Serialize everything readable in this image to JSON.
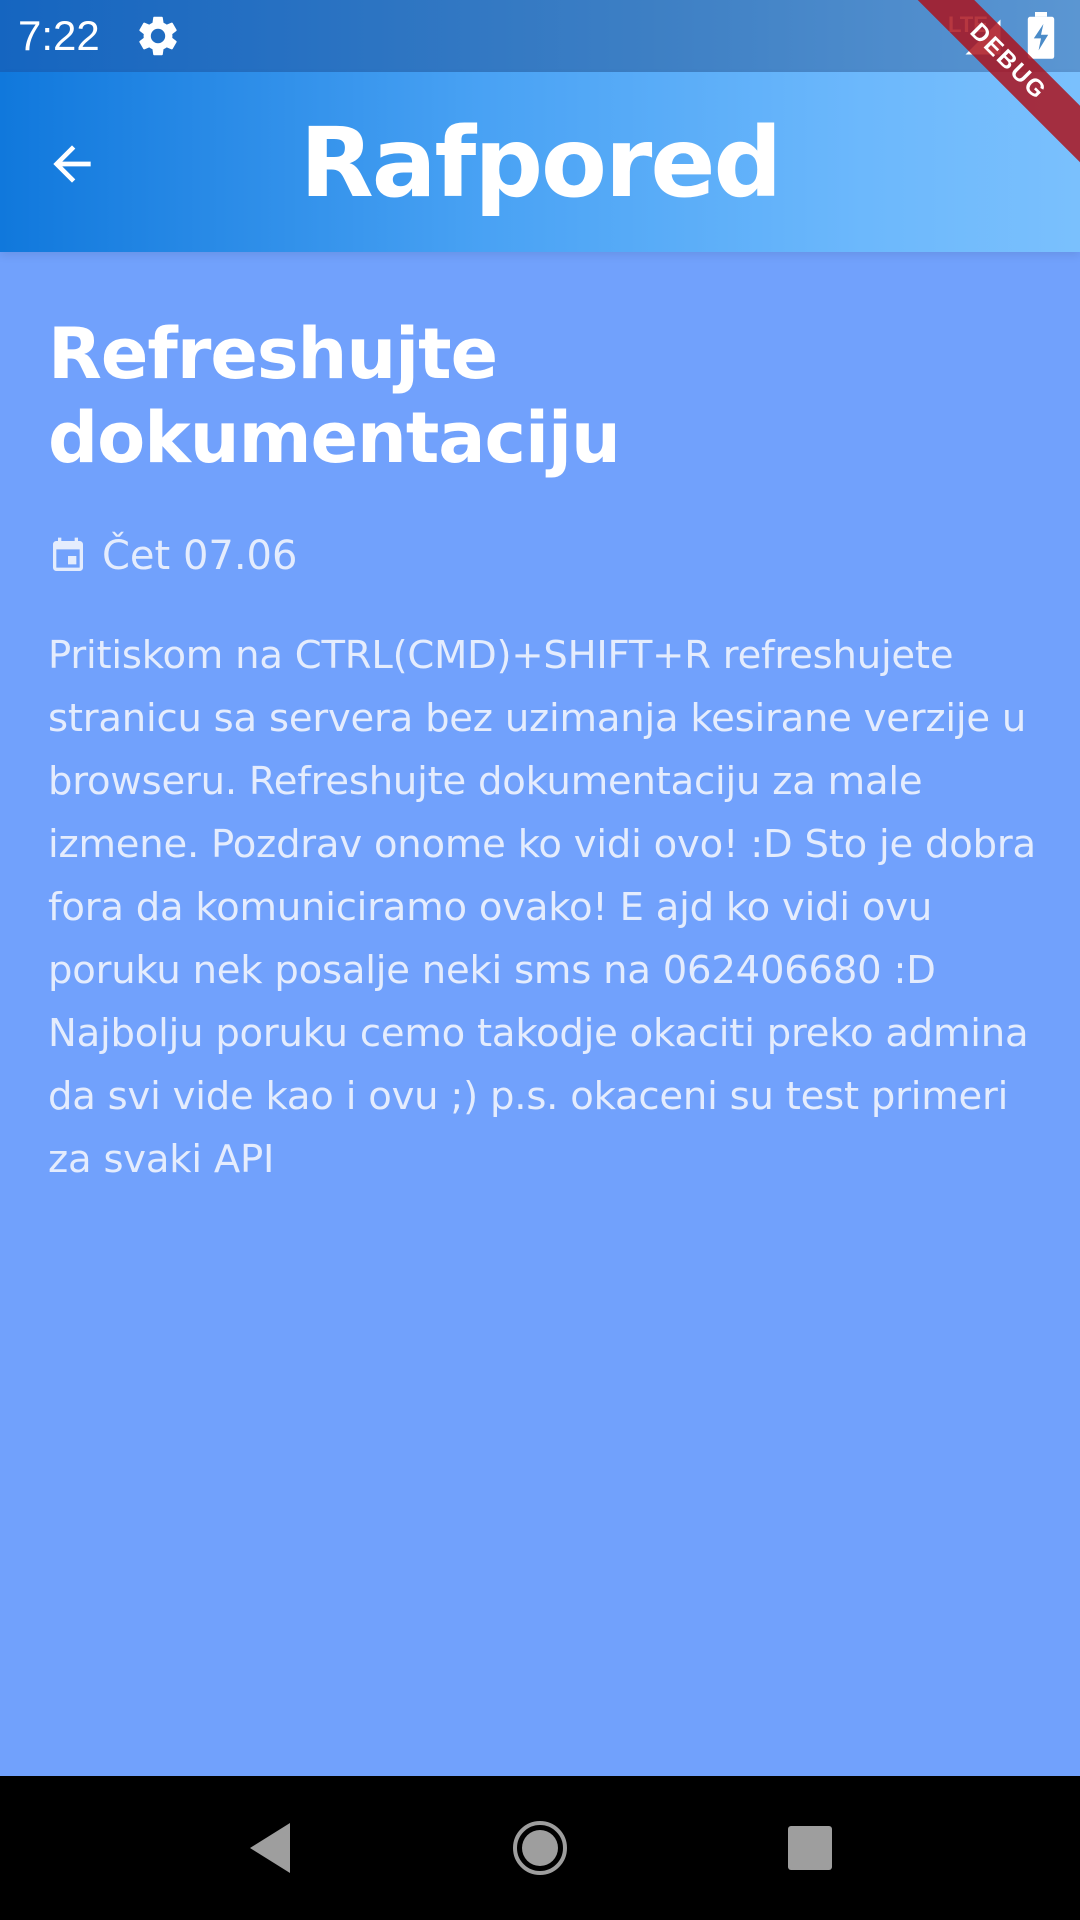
{
  "status_bar": {
    "time": "7:22",
    "network": "LTE",
    "icons": [
      "gear-icon",
      "signal-icon",
      "battery-charging-icon"
    ]
  },
  "app_bar": {
    "title": "Rafpored",
    "back_icon": "arrow-left-icon",
    "debug_banner": "DEBUG"
  },
  "article": {
    "title": "Refreshujte dokumentaciju",
    "date_icon": "calendar-icon",
    "date": "Čet 07.06",
    "body": "Pritiskom na CTRL(CMD)+SHIFT+R refreshujete stranicu sa servera bez uzimanja kesirane verzije u browseru. Refreshujte dokumentaciju za male izmene. Pozdrav onome ko vidi ovo! :D Sto je dobra fora da komuniciramo ovako! E ajd ko vidi ovu poruku nek posalje neki sms na 062406680 :D Najbolju poruku cemo takodje okaciti preko admina da svi vide kao i ovu ;) p.s. okaceni su test primeri za svaki API"
  },
  "nav_bar": {
    "buttons": [
      "back-triangle-icon",
      "home-circle-icon",
      "recents-square-icon"
    ]
  },
  "colors": {
    "background": "#71a1fc",
    "app_bar_start": "#1078dc",
    "app_bar_end": "#7ac0fd",
    "status_bar": "#1565c0",
    "debug_ribbon": "#aa141e"
  }
}
